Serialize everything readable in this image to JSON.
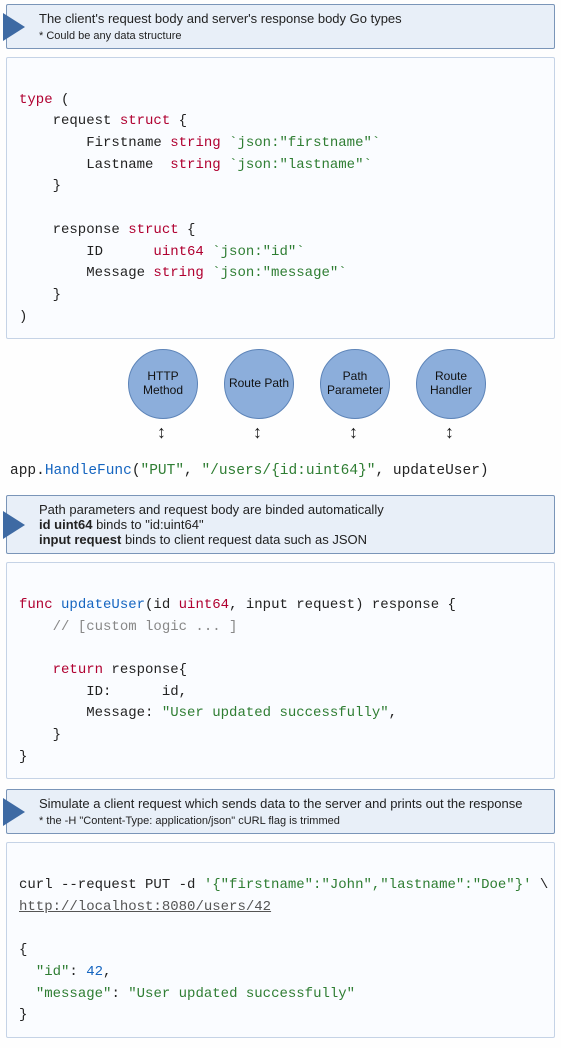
{
  "callout1": {
    "title": "The client's request body and server's response body Go types",
    "sub": "* Could be any data structure"
  },
  "code1": {
    "l1a": "type",
    "l1b": " (",
    "l2a": "    request ",
    "l2b": "struct",
    "l2c": " {",
    "l3a": "        Firstname ",
    "l3b": "string",
    "l3c": " ",
    "l3d": "`json:\"firstname\"`",
    "l4a": "        Lastname  ",
    "l4b": "string",
    "l4c": " ",
    "l4d": "`json:\"lastname\"`",
    "l5": "    }",
    "l6": "",
    "l7a": "    response ",
    "l7b": "struct",
    "l7c": " {",
    "l8a": "        ID      ",
    "l8b": "uint64",
    "l8c": " ",
    "l8d": "`json:\"id\"`",
    "l9a": "        Message ",
    "l9b": "string",
    "l9c": " ",
    "l9d": "`json:\"message\"`",
    "l10": "    }",
    "l11": ")"
  },
  "diagram": {
    "b1": "HTTP\nMethod",
    "b2": "Route\nPath",
    "b3": "Path\nParameter",
    "b4": "Route\nHandler",
    "arrow": "↕"
  },
  "route": {
    "p1": "app.",
    "p2": "HandleFunc",
    "p3": "(",
    "p4": "\"PUT\"",
    "p5": ", ",
    "p6": "\"/users/{id:uint64}\"",
    "p7": ", updateUser)"
  },
  "callout2": {
    "l1": "Path parameters and request body are binded automatically",
    "l2a": "id uint64",
    "l2b": " binds to \"id:uint64\"",
    "l3a": "input request",
    "l3b": " binds to client request data such as JSON"
  },
  "code2": {
    "l1a": "func",
    "l1b": " ",
    "l1c": "updateUser",
    "l1d": "(id ",
    "l1e": "uint64",
    "l1f": ", input request) response {",
    "l2a": "    ",
    "l2b": "// [custom logic ... ]",
    "l3": "",
    "l4a": "    ",
    "l4b": "return",
    "l4c": " response{",
    "l5a": "        ID:      id,",
    "l6a": "        Message: ",
    "l6b": "\"User updated successfully\"",
    "l6c": ",",
    "l7": "    }",
    "l8": "}"
  },
  "callout3": {
    "title": "Simulate a client request which sends data to the server and prints out the response",
    "sub": "* the -H \"Content-Type: application/json\" cURL flag is trimmed"
  },
  "code3": {
    "l1a": "curl --request PUT -d ",
    "l1b": "'{\"firstname\":\"John\",\"lastname\":\"Doe\"}'",
    "l1c": " \\",
    "l2a": "http:",
    "l2b": "//localhost:8080/users/42",
    "l3": "",
    "l4": "{",
    "l5a": "  ",
    "l5b": "\"id\"",
    "l5c": ": ",
    "l5d": "42",
    "l5e": ",",
    "l6a": "  ",
    "l6b": "\"message\"",
    "l6c": ": ",
    "l6d": "\"User updated successfully\"",
    "l7": "}"
  }
}
